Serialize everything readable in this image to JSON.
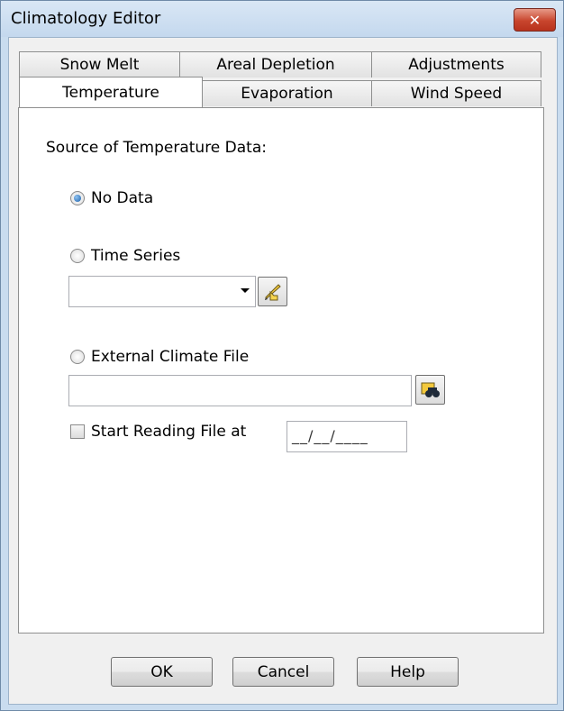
{
  "window": {
    "title": "Climatology Editor",
    "close_symbol": "✕"
  },
  "tabs": {
    "row1": [
      {
        "label": "Snow Melt"
      },
      {
        "label": "Areal Depletion"
      },
      {
        "label": "Adjustments"
      }
    ],
    "row2": [
      {
        "label": "Temperature",
        "active": true
      },
      {
        "label": "Evaporation"
      },
      {
        "label": "Wind Speed"
      }
    ]
  },
  "temperature": {
    "source_label": "Source of Temperature Data:",
    "options": {
      "no_data": "No Data",
      "time_series": "Time Series",
      "external_file": "External Climate File"
    },
    "selected_option": "no_data",
    "time_series_value": "",
    "external_file_value": "",
    "start_reading_label": "Start Reading File at",
    "start_reading_checked": false,
    "start_date_value": "__/__/____",
    "icons": {
      "time_series_edit": "pencil-edit-icon",
      "file_browse": "binoculars-browse-icon"
    }
  },
  "buttons": {
    "ok": "OK",
    "cancel": "Cancel",
    "help": "Help"
  }
}
